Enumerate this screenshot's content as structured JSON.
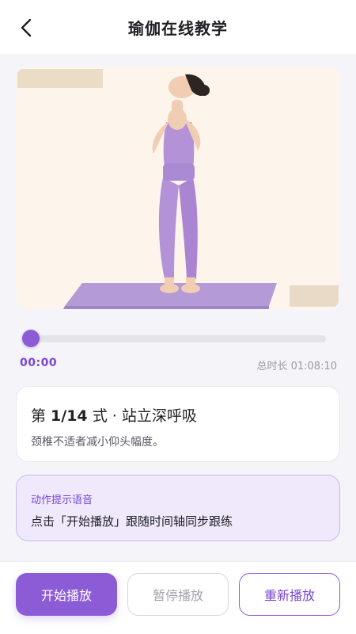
{
  "header": {
    "title": "瑜伽在线教学",
    "back_icon": "chevron-left-icon"
  },
  "illustration": {
    "description_icon": "yoga-pose-illustration",
    "bg_color": "#fdf5ec",
    "mat_color": "#b49ad6"
  },
  "player": {
    "progress_fraction": 0.0,
    "current_time": "00:00",
    "total_time": "总时长 01:08:10"
  },
  "step": {
    "prefix": "第 ",
    "number": "1/14",
    "suffix": " 式 · 站立深呼吸",
    "description": "颈椎不适者减小仰头幅度。"
  },
  "voice_hint": {
    "label": "动作提示语音",
    "text": "点击「开始播放」跟随时间轴同步跟练"
  },
  "controls": {
    "start_label": "开始播放",
    "pause_label": "暂停播放",
    "restart_label": "重新播放"
  },
  "colors": {
    "accent": "#8c5bd6",
    "accent_text": "#7a46d3",
    "hint_bg": "#efe9fb"
  }
}
